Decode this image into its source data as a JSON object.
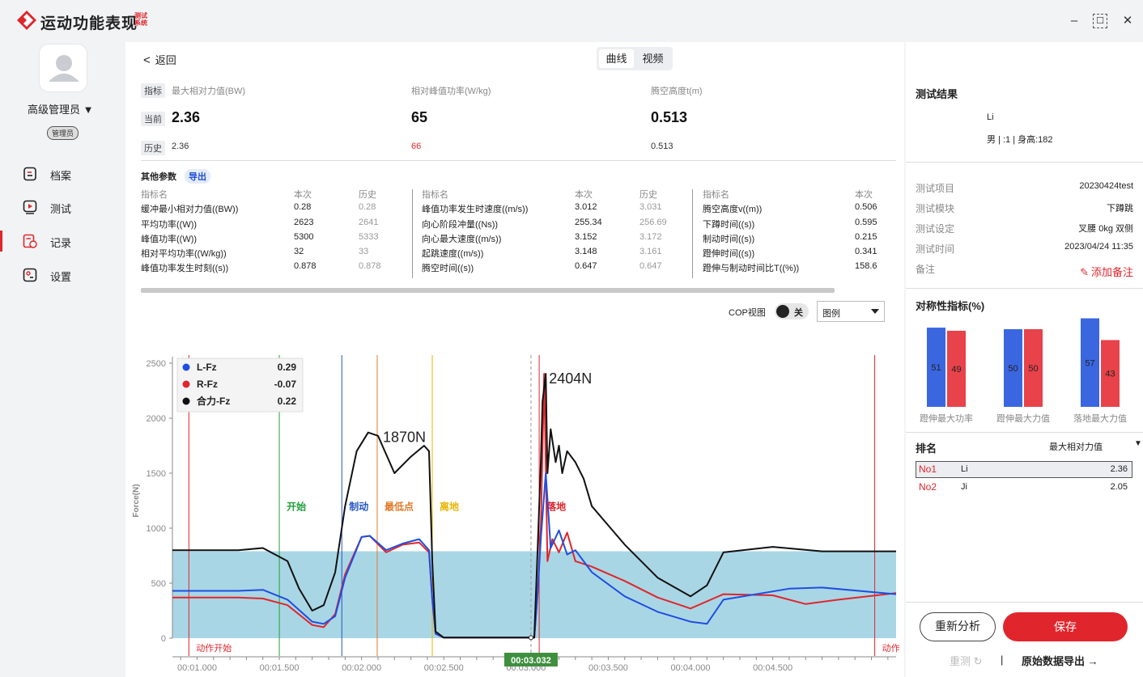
{
  "app": {
    "title": "运动功能表现",
    "subtitle": "测试系统",
    "minimize": "–",
    "maximize": "☐",
    "close": "✕"
  },
  "user": {
    "name": "高级管理员 ▼",
    "role": "管理员"
  },
  "nav": [
    {
      "label": "档案",
      "icon": "file-icon"
    },
    {
      "label": "测试",
      "icon": "play-icon"
    },
    {
      "label": "记录",
      "icon": "record-icon"
    },
    {
      "label": "设置",
      "icon": "settings-icon"
    }
  ],
  "header": {
    "back": "返回",
    "tabs": [
      "曲线",
      "视频"
    ]
  },
  "metrics": {
    "row_tags": [
      "指标",
      "当前",
      "历史"
    ],
    "cols": [
      {
        "label": "最大相对力值(BW)",
        "current": "2.36",
        "history": "2.36"
      },
      {
        "label": "相对峰值功率(W/kg)",
        "current": "65",
        "history": "66"
      },
      {
        "label": "腾空高度t(m)",
        "current": "0.513",
        "history": "0.513"
      }
    ]
  },
  "other_params": {
    "title": "其他参数",
    "export": "导出",
    "headers": [
      "指标名",
      "本次",
      "历史"
    ],
    "group1": [
      [
        "缓冲最小相对力值((BW))",
        "0.28",
        "0.28"
      ],
      [
        "平均功率((W))",
        "2623",
        "2641"
      ],
      [
        "峰值功率((W))",
        "5300",
        "5333"
      ],
      [
        "相对平均功率((W/kg))",
        "32",
        "33"
      ],
      [
        "峰值功率发生时刻((s))",
        "0.878",
        "0.878"
      ]
    ],
    "group2": [
      [
        "峰值功率发生时速度((m/s))",
        "3.012",
        "3.031"
      ],
      [
        "向心阶段冲量((Ns))",
        "255.34",
        "256.69"
      ],
      [
        "向心最大速度((m/s))",
        "3.152",
        "3.172"
      ],
      [
        "起跳速度((m/s))",
        "3.148",
        "3.161"
      ],
      [
        "腾空时间((s))",
        "0.647",
        "0.647"
      ]
    ],
    "group3": [
      [
        "腾空高度v((m))",
        "0.506"
      ],
      [
        "下蹲时间((s))",
        "0.595"
      ],
      [
        "制动时间((s))",
        "0.215"
      ],
      [
        "蹬伸时间((s))",
        "0.341"
      ],
      [
        "蹬伸与制动时间比T((%))",
        "158.6"
      ]
    ]
  },
  "chart_controls": {
    "cop_label": "COP视图",
    "toggle": "关",
    "legend_select": "图例"
  },
  "chart_data": {
    "type": "line",
    "ylabel": "Force(N)",
    "ylim": [
      0,
      2500
    ],
    "yticks": [
      "0",
      "500",
      "1000",
      "1500",
      "2000",
      "2500"
    ],
    "xticks": [
      "00:01.000",
      "00:01.500",
      "00:02.000",
      "00:02.500",
      "00:03.000",
      "00:03.500",
      "00:04.000",
      "00:04.500"
    ],
    "xlim": [
      0.85,
      5.25
    ],
    "cursor_label": "00:03.032",
    "legend": [
      {
        "name": "L-Fz",
        "value": "0.29",
        "color": "#1f4fe0"
      },
      {
        "name": "R-Fz",
        "value": "-0.07",
        "color": "#e0262c"
      },
      {
        "name": "合力-Fz",
        "value": "0.22",
        "color": "#111111"
      }
    ],
    "band": [
      0,
      790
    ],
    "annotations": [
      {
        "text": "1870N",
        "x": 2.1,
        "y": 1870
      },
      {
        "text": "2404N",
        "x": 3.11,
        "y": 2404
      }
    ],
    "phases": [
      {
        "label": "动作开始",
        "x": 0.95,
        "color": "#e0262c"
      },
      {
        "label": "开始",
        "x": 1.5,
        "color": "#22a03a"
      },
      {
        "label": "制动",
        "x": 1.88,
        "color": "#2457c5"
      },
      {
        "label": "最低点",
        "x": 2.095,
        "color": "#e07a2a"
      },
      {
        "label": "离地",
        "x": 2.43,
        "color": "#e8b400"
      },
      {
        "label": "落地",
        "x": 3.08,
        "color": "#e0262c"
      },
      {
        "label": "动作",
        "x": 5.12,
        "color": "#e0262c"
      }
    ],
    "series": [
      {
        "name": "合力-Fz",
        "color": "#111111",
        "x": [
          0.85,
          1.25,
          1.4,
          1.55,
          1.62,
          1.7,
          1.77,
          1.84,
          1.9,
          1.97,
          2.04,
          2.1,
          2.2,
          2.3,
          2.38,
          2.41,
          2.43,
          2.45,
          2.5,
          3.05,
          3.07,
          3.09,
          3.1,
          3.12,
          3.13,
          3.15,
          3.18,
          3.2,
          3.22,
          3.25,
          3.3,
          3.35,
          3.4,
          3.6,
          3.8,
          4.0,
          4.1,
          4.2,
          4.5,
          4.8,
          5.25
        ],
        "y": [
          800,
          800,
          820,
          700,
          450,
          250,
          300,
          600,
          1200,
          1700,
          1870,
          1840,
          1500,
          1650,
          1750,
          1700,
          700,
          60,
          5,
          5,
          800,
          1600,
          2150,
          2404,
          1500,
          1900,
          1600,
          1750,
          1500,
          1700,
          1600,
          1450,
          1200,
          850,
          550,
          380,
          480,
          780,
          830,
          790,
          790
        ]
      },
      {
        "name": "L-Fz",
        "color": "#1f4fe0",
        "x": [
          0.85,
          1.25,
          1.4,
          1.55,
          1.7,
          1.77,
          1.84,
          1.9,
          2.0,
          2.05,
          2.15,
          2.25,
          2.35,
          2.41,
          2.43,
          2.45,
          2.5,
          3.05,
          3.07,
          3.09,
          3.12,
          3.15,
          3.2,
          3.25,
          3.3,
          3.4,
          3.6,
          3.8,
          4.0,
          4.1,
          4.2,
          4.6,
          4.8,
          5.25
        ],
        "y": [
          430,
          430,
          440,
          350,
          150,
          130,
          200,
          550,
          920,
          930,
          800,
          860,
          900,
          800,
          350,
          40,
          5,
          5,
          400,
          900,
          1500,
          820,
          980,
          760,
          800,
          600,
          380,
          240,
          150,
          130,
          350,
          450,
          460,
          400
        ]
      },
      {
        "name": "R-Fz",
        "color": "#e0262c",
        "x": [
          0.85,
          1.25,
          1.4,
          1.55,
          1.7,
          1.77,
          1.84,
          1.9,
          2.0,
          2.05,
          2.15,
          2.25,
          2.35,
          2.41,
          2.43,
          2.45,
          2.5,
          3.05,
          3.07,
          3.09,
          3.11,
          3.13,
          3.16,
          3.2,
          3.25,
          3.3,
          3.4,
          3.6,
          3.8,
          4.0,
          4.2,
          4.5,
          4.7,
          4.9,
          5.25
        ],
        "y": [
          370,
          370,
          360,
          300,
          120,
          100,
          220,
          580,
          920,
          930,
          780,
          850,
          870,
          780,
          350,
          40,
          5,
          5,
          400,
          1000,
          2404,
          700,
          900,
          780,
          960,
          700,
          650,
          520,
          370,
          270,
          400,
          390,
          310,
          350,
          410
        ]
      }
    ]
  },
  "results": {
    "title": "测试结果",
    "name": "Li",
    "info": "男 | :1 | 身高:182",
    "fields": [
      {
        "label": "测试项目",
        "value": "20230424test"
      },
      {
        "label": "测试模块",
        "value": "下蹲跳"
      },
      {
        "label": "测试设定",
        "value": "叉腰 0kg 双侧"
      },
      {
        "label": "测试时间",
        "value": "2023/04/24 11:35"
      },
      {
        "label": "备注",
        "value": ""
      }
    ],
    "add_note": "添加备注"
  },
  "symmetry": {
    "title": "对称性指标(%)",
    "groups": [
      {
        "label": "蹬伸最大功率",
        "left": 51,
        "right": 49
      },
      {
        "label": "蹬伸最大力值",
        "left": 50,
        "right": 50
      },
      {
        "label": "落地最大力值",
        "left": 57,
        "right": 43
      }
    ],
    "colors": {
      "left": "#3a66e0",
      "right": "#e8424a"
    }
  },
  "ranking": {
    "title": "排名",
    "metric": "最大相对力值",
    "rows": [
      {
        "rank": "No1",
        "name": "Li",
        "value": "2.36"
      },
      {
        "rank": "No2",
        "name": "Ji",
        "value": "2.05"
      }
    ]
  },
  "actions": {
    "reanalyze": "重新分析",
    "save": "保存",
    "retest": "重测",
    "sep": "|",
    "export_raw": "原始数据导出"
  }
}
